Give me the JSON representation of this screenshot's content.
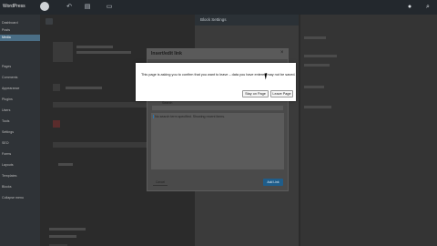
{
  "admin_bar": {
    "site_label": "WordPress",
    "icons": [
      "wp-logo-icon",
      "customize-icon",
      "comments-icon",
      "new-icon",
      "user-icon",
      "search-icon"
    ]
  },
  "sidebar": {
    "items": [
      "Dashboard",
      "Posts",
      "Media",
      "Pages",
      "Comments",
      "Appearance",
      "Plugins",
      "Users",
      "Tools",
      "Settings",
      "SEO",
      "Forms",
      "Layouts",
      "Templates",
      "Blocks",
      "Collapse menu"
    ]
  },
  "settings_panel": {
    "title": "Block Settings"
  },
  "insert_link_modal": {
    "title": "Insert/edit link",
    "close": "×",
    "search_label": "Search",
    "no_results": "No search term specified. Showing recent items.",
    "cancel_label": "Cancel",
    "add_link_label": "Add Link"
  },
  "confirm_dialog": {
    "message": "This page is asking you to confirm that you want to leave – data you have entered may not be saved.",
    "stay_label": "Stay on Page",
    "leave_label": "Leave Page"
  },
  "colors": {
    "primary_button": "#1f5d8a",
    "admin_bar": "#23282d",
    "sidebar_active": "#4a6e86"
  }
}
